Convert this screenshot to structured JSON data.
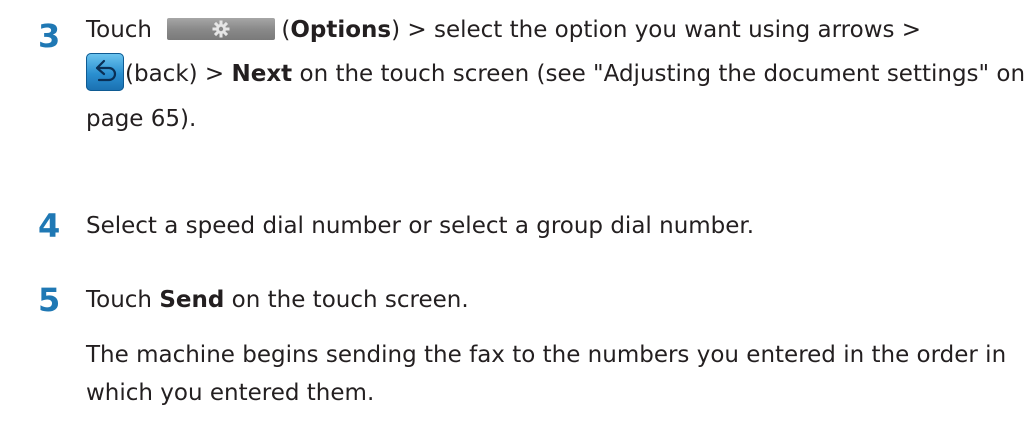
{
  "steps": [
    {
      "number": "3",
      "lines": {
        "t1": "Touch",
        "options_label": "Options",
        "t2": " > select the option you want using arrows >",
        "back_label": "(back) > ",
        "next_label": "Next",
        "t3": " on the touch screen (see \"Adjusting the document settings\" on page 65)."
      },
      "icons": [
        "options-gear-icon",
        "back-arrow-icon"
      ]
    },
    {
      "number": "4",
      "text": "Select a speed dial number or select a group dial number."
    },
    {
      "number": "5",
      "t1": "Touch ",
      "send_label": "Send",
      "t2": " on the touch screen.",
      "followup": "The machine begins sending the fax to the numbers you entered in the order in which you entered them."
    }
  ],
  "colors": {
    "step_number": "#1f78b4",
    "text": "#231f20"
  }
}
